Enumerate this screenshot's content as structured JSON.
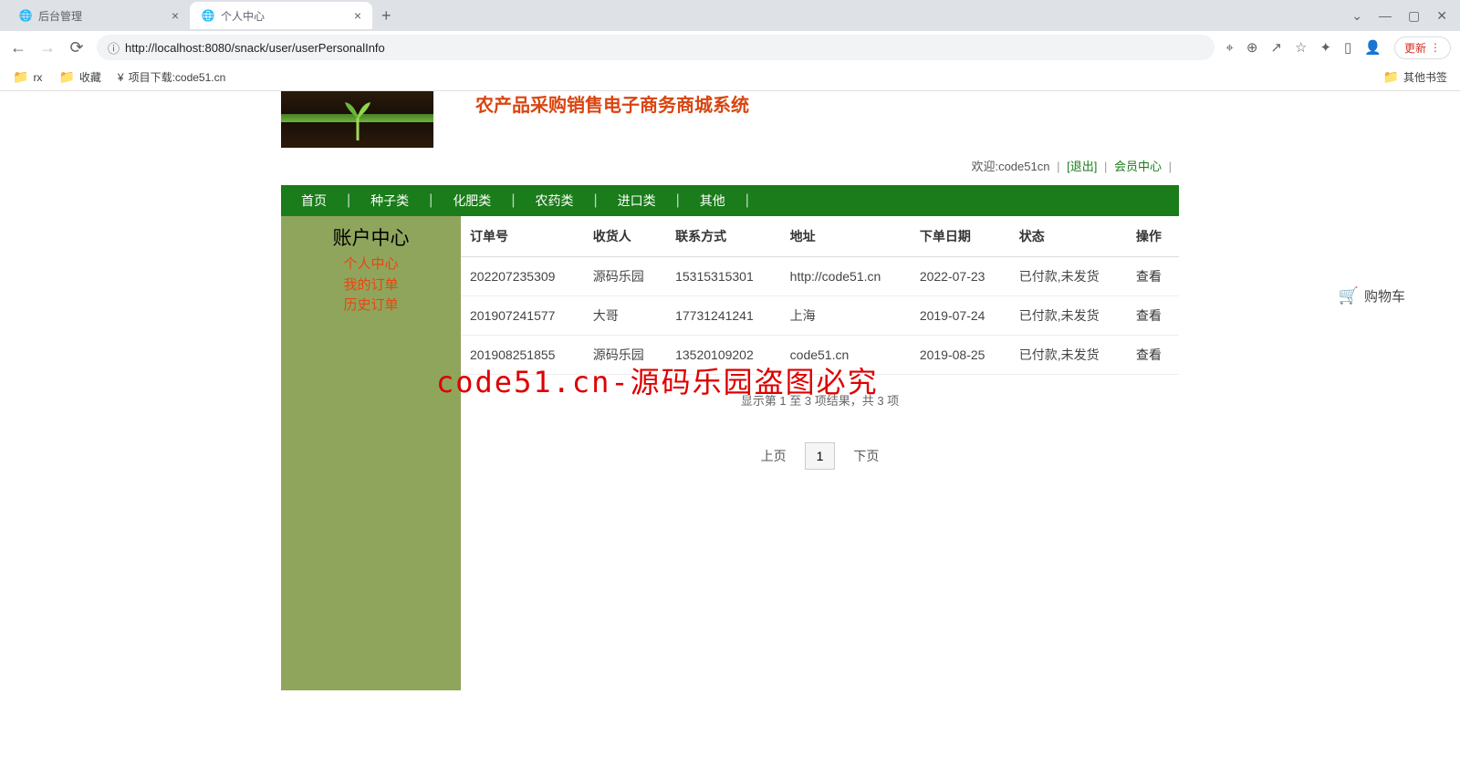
{
  "browser": {
    "tabs": [
      {
        "title": "后台管理",
        "active": false
      },
      {
        "title": "个人中心",
        "active": true
      }
    ],
    "url_prefix": "http://",
    "url_host": "localhost",
    "url_port": ":8080",
    "url_path": "/snack/user/userPersonalInfo",
    "update_label": "更新",
    "bookmarks": [
      {
        "label": "rx",
        "type": "folder"
      },
      {
        "label": "收藏",
        "type": "folder"
      },
      {
        "label": "项目下载:code51.cn",
        "type": "link"
      }
    ],
    "other_bookmarks": "其他书签"
  },
  "site": {
    "title": "农产品采购销售电子商务商城系统"
  },
  "user_bar": {
    "welcome": "欢迎:code51cn",
    "logout": "[退出]",
    "member_center": "会员中心"
  },
  "nav": [
    "首页",
    "种子类",
    "化肥类",
    "农药类",
    "进口类",
    "其他"
  ],
  "sidebar": {
    "title": "账户中心",
    "links": [
      "个人中心",
      "我的订单",
      "历史订单"
    ]
  },
  "table": {
    "headers": [
      "订单号",
      "收货人",
      "联系方式",
      "地址",
      "下单日期",
      "状态",
      "操作"
    ],
    "rows": [
      {
        "order_no": "202207235309",
        "recipient": "源码乐园",
        "phone": "15315315301",
        "address": "http://code51.cn",
        "date": "2022-07-23",
        "status": "已付款,未发货",
        "action": "查看"
      },
      {
        "order_no": "201907241577",
        "recipient": "大哥",
        "phone": "17731241241",
        "address": "上海",
        "date": "2019-07-24",
        "status": "已付款,未发货",
        "action": "查看"
      },
      {
        "order_no": "201908251855",
        "recipient": "源码乐园",
        "phone": "13520109202",
        "address": "code51.cn",
        "date": "2019-08-25",
        "status": "已付款,未发货",
        "action": "查看"
      }
    ]
  },
  "pagination": {
    "info": "显示第 1 至 3 项结果，共 3 项",
    "prev": "上页",
    "current": "1",
    "next": "下页"
  },
  "watermark": "code51.cn-源码乐园盗图必究",
  "cart": "购物车"
}
